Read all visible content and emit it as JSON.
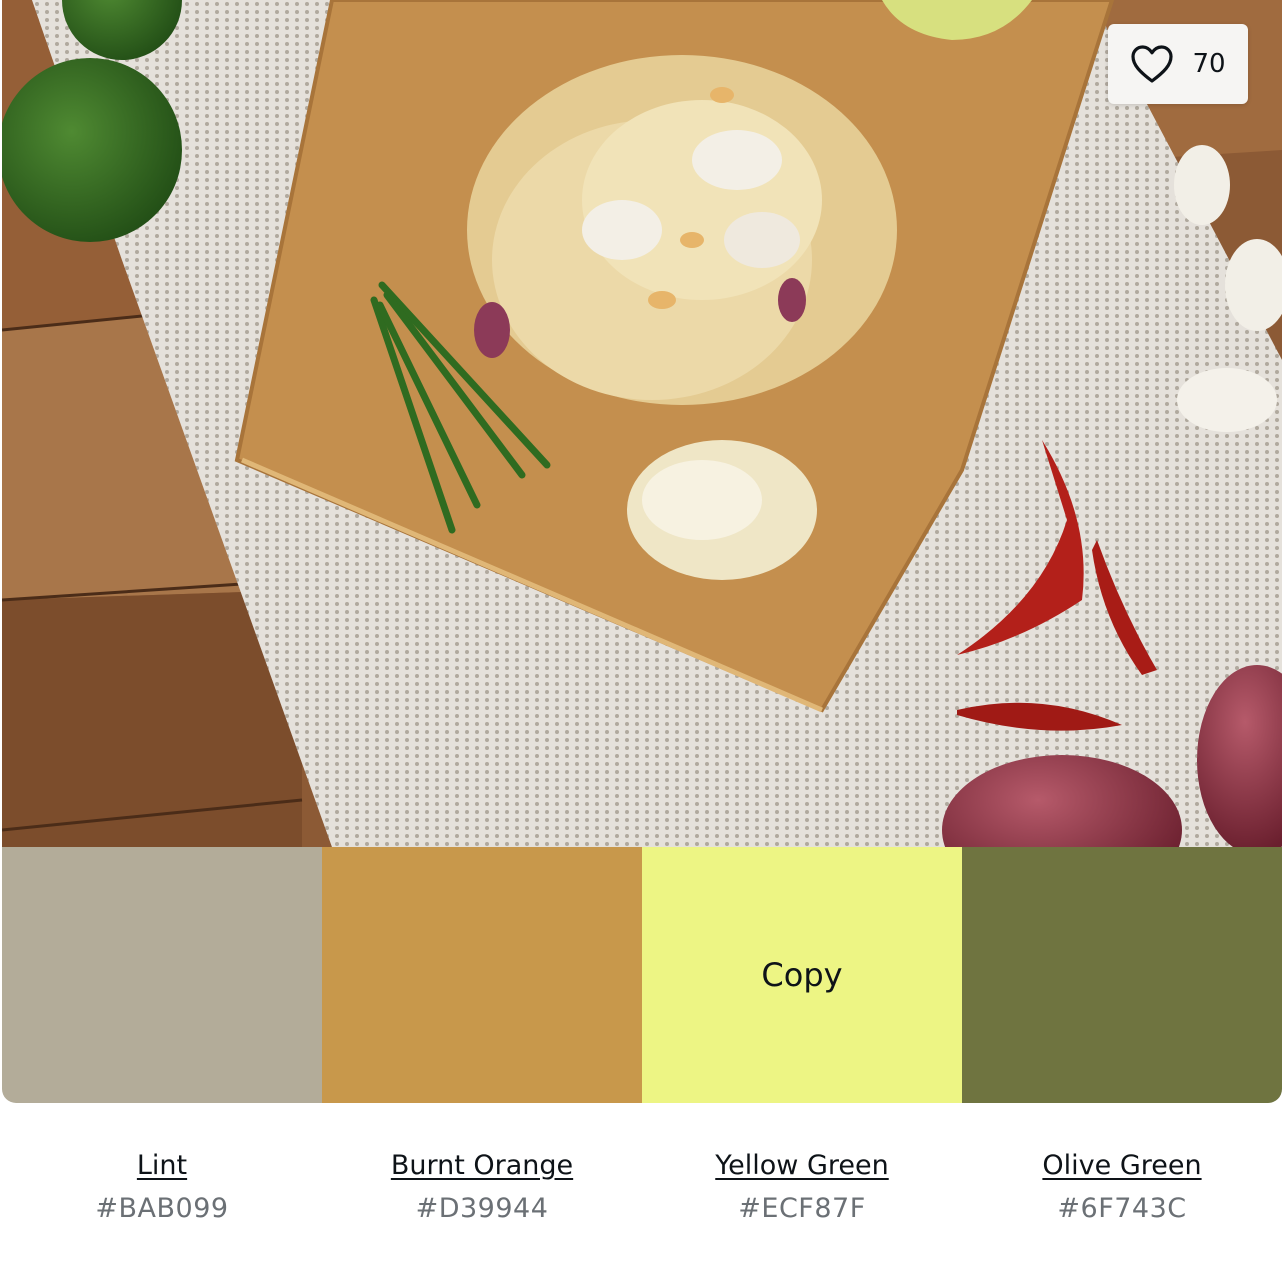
{
  "photo": {
    "icon": "food-photo-pad-thai"
  },
  "like": {
    "icon": "heart-icon",
    "count": "70"
  },
  "swatches": [
    {
      "name": "Lint",
      "hex": "#BAB099",
      "color": "#B3AC99",
      "hover_label": ""
    },
    {
      "name": "Burnt Orange",
      "hex": "#D39944",
      "color": "#C8984B",
      "hover_label": ""
    },
    {
      "name": "Yellow Green",
      "hex": "#ECF87F",
      "color": "#EDF584",
      "hover_label": "Copy"
    },
    {
      "name": "Olive Green",
      "hex": "#6F743C",
      "color": "#6F7440",
      "hover_label": ""
    }
  ]
}
